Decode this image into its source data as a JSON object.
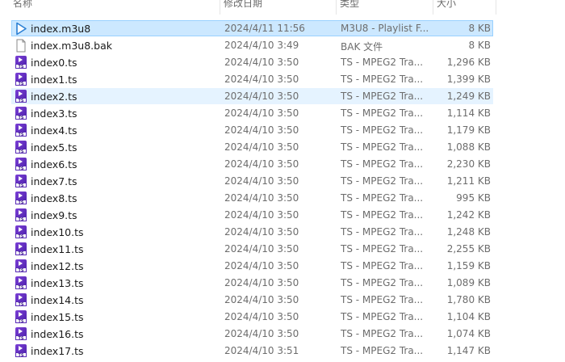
{
  "columns": {
    "name": "名称",
    "date": "修改日期",
    "type": "类型",
    "size": "大小"
  },
  "files": [
    {
      "name": "index.m3u8",
      "date": "2024/4/11 11:56",
      "type": "M3U8 - Playlist F...",
      "size": "8 KB",
      "icon": "playlist-icon",
      "state": "selected"
    },
    {
      "name": "index.m3u8.bak",
      "date": "2024/4/10 3:49",
      "type": "BAK 文件",
      "size": "8 KB",
      "icon": "blank-file-icon",
      "state": ""
    },
    {
      "name": "index0.ts",
      "date": "2024/4/10 3:50",
      "type": "TS - MPEG2 Tra...",
      "size": "1,296 KB",
      "icon": "ts-video-icon",
      "state": ""
    },
    {
      "name": "index1.ts",
      "date": "2024/4/10 3:50",
      "type": "TS - MPEG2 Tra...",
      "size": "1,399 KB",
      "icon": "ts-video-icon",
      "state": ""
    },
    {
      "name": "index2.ts",
      "date": "2024/4/10 3:50",
      "type": "TS - MPEG2 Tra...",
      "size": "1,249 KB",
      "icon": "ts-video-icon",
      "state": "hover"
    },
    {
      "name": "index3.ts",
      "date": "2024/4/10 3:50",
      "type": "TS - MPEG2 Tra...",
      "size": "1,114 KB",
      "icon": "ts-video-icon",
      "state": ""
    },
    {
      "name": "index4.ts",
      "date": "2024/4/10 3:50",
      "type": "TS - MPEG2 Tra...",
      "size": "1,179 KB",
      "icon": "ts-video-icon",
      "state": ""
    },
    {
      "name": "index5.ts",
      "date": "2024/4/10 3:50",
      "type": "TS - MPEG2 Tra...",
      "size": "1,088 KB",
      "icon": "ts-video-icon",
      "state": ""
    },
    {
      "name": "index6.ts",
      "date": "2024/4/10 3:50",
      "type": "TS - MPEG2 Tra...",
      "size": "2,230 KB",
      "icon": "ts-video-icon",
      "state": ""
    },
    {
      "name": "index7.ts",
      "date": "2024/4/10 3:50",
      "type": "TS - MPEG2 Tra...",
      "size": "1,211 KB",
      "icon": "ts-video-icon",
      "state": ""
    },
    {
      "name": "index8.ts",
      "date": "2024/4/10 3:50",
      "type": "TS - MPEG2 Tra...",
      "size": "995 KB",
      "icon": "ts-video-icon",
      "state": ""
    },
    {
      "name": "index9.ts",
      "date": "2024/4/10 3:50",
      "type": "TS - MPEG2 Tra...",
      "size": "1,242 KB",
      "icon": "ts-video-icon",
      "state": ""
    },
    {
      "name": "index10.ts",
      "date": "2024/4/10 3:50",
      "type": "TS - MPEG2 Tra...",
      "size": "1,248 KB",
      "icon": "ts-video-icon",
      "state": ""
    },
    {
      "name": "index11.ts",
      "date": "2024/4/10 3:50",
      "type": "TS - MPEG2 Tra...",
      "size": "2,255 KB",
      "icon": "ts-video-icon",
      "state": ""
    },
    {
      "name": "index12.ts",
      "date": "2024/4/10 3:50",
      "type": "TS - MPEG2 Tra...",
      "size": "1,159 KB",
      "icon": "ts-video-icon",
      "state": ""
    },
    {
      "name": "index13.ts",
      "date": "2024/4/10 3:50",
      "type": "TS - MPEG2 Tra...",
      "size": "1,089 KB",
      "icon": "ts-video-icon",
      "state": ""
    },
    {
      "name": "index14.ts",
      "date": "2024/4/10 3:50",
      "type": "TS - MPEG2 Tra...",
      "size": "1,780 KB",
      "icon": "ts-video-icon",
      "state": ""
    },
    {
      "name": "index15.ts",
      "date": "2024/4/10 3:50",
      "type": "TS - MPEG2 Tra...",
      "size": "1,104 KB",
      "icon": "ts-video-icon",
      "state": ""
    },
    {
      "name": "index16.ts",
      "date": "2024/4/10 3:50",
      "type": "TS - MPEG2 Tra...",
      "size": "1,074 KB",
      "icon": "ts-video-icon",
      "state": ""
    },
    {
      "name": "index17.ts",
      "date": "2024/4/10 3:51",
      "type": "TS - MPEG2 Tra...",
      "size": "1,147 KB",
      "icon": "ts-video-icon",
      "state": ""
    }
  ],
  "ts_icon_label": "TS",
  "colors": {
    "selected_bg": "#cce8ff",
    "selected_border": "#99d1ff",
    "hover_bg": "#e5f3ff",
    "ts_icon": "#5a2bb8",
    "playlist_icon": "#2a7fd4"
  }
}
